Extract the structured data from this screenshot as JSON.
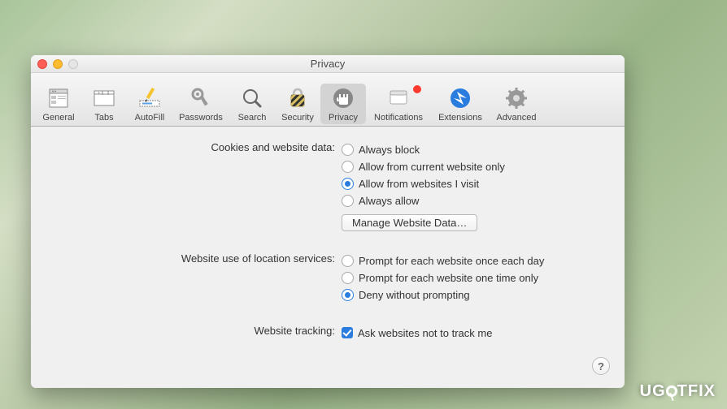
{
  "window": {
    "title": "Privacy"
  },
  "toolbar": {
    "items": [
      {
        "label": "General"
      },
      {
        "label": "Tabs"
      },
      {
        "label": "AutoFill"
      },
      {
        "label": "Passwords"
      },
      {
        "label": "Search"
      },
      {
        "label": "Security"
      },
      {
        "label": "Privacy"
      },
      {
        "label": "Notifications"
      },
      {
        "label": "Extensions"
      },
      {
        "label": "Advanced"
      }
    ]
  },
  "sections": {
    "cookies": {
      "label": "Cookies and website data:",
      "options": [
        "Always block",
        "Allow from current website only",
        "Allow from websites I visit",
        "Always allow"
      ],
      "button": "Manage Website Data…"
    },
    "location": {
      "label": "Website use of location services:",
      "options": [
        "Prompt for each website once each day",
        "Prompt for each website one time only",
        "Deny without prompting"
      ]
    },
    "tracking": {
      "label": "Website tracking:",
      "option": "Ask websites not to track me"
    }
  },
  "help_glyph": "?",
  "watermark": {
    "prefix": "UG",
    "suffix": "TFIX"
  }
}
